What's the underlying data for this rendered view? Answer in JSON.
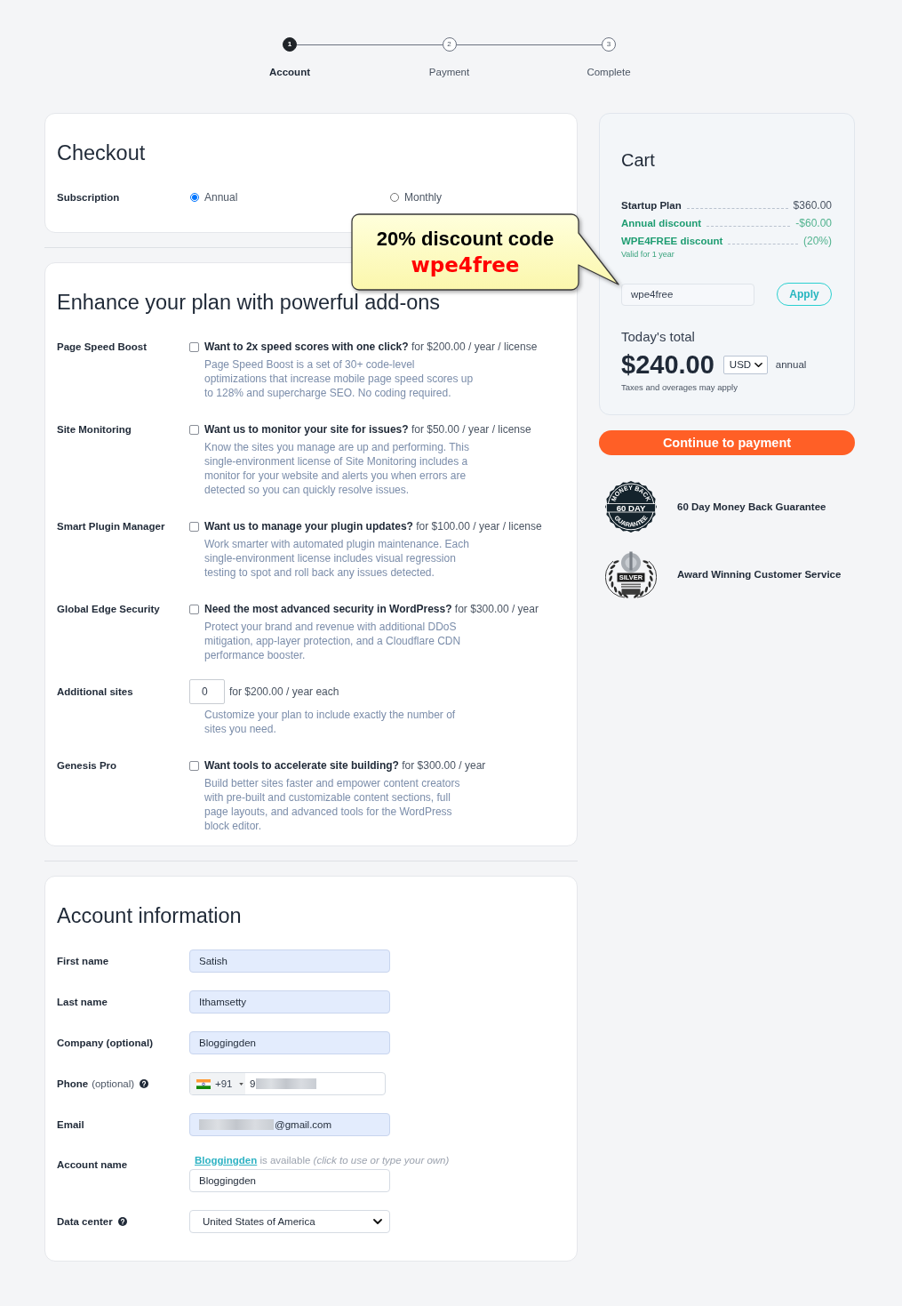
{
  "stepper": {
    "steps": [
      {
        "number": "1",
        "label": "Account",
        "selected": true
      },
      {
        "number": "2",
        "label": "Payment",
        "selected": false
      },
      {
        "number": "3",
        "label": "Complete",
        "selected": false
      }
    ]
  },
  "checkout": {
    "title": "Checkout",
    "subscription": {
      "label": "Subscription",
      "options": [
        {
          "label": "Annual",
          "selected": true
        },
        {
          "label": "Monthly",
          "selected": false
        }
      ]
    }
  },
  "callout": {
    "title": "20% discount code",
    "code": "wpe4free"
  },
  "addons": {
    "title": "Enhance your plan with powerful add-ons",
    "items": [
      {
        "kind": "checkbox",
        "name": "Page Speed Boost",
        "checked": false,
        "offer": "**Want to 2x speed scores with one click?** for $200.00 / year / license",
        "description": "Page Speed Boost is a set of 30+ code-level optimizations that increase mobile page speed scores up to 128% and supercharge SEO. No coding required."
      },
      {
        "kind": "checkbox",
        "name": "Site Monitoring",
        "checked": false,
        "offer": "**Want us to monitor your site for issues?** for $50.00 / year / license",
        "description": "Know the sites you manage are up and performing. This single-environment license of Site Monitoring includes a monitor for your website and alerts you when errors are detected so you can quickly resolve issues."
      },
      {
        "kind": "checkbox",
        "name": "Smart Plugin Manager",
        "checked": false,
        "offer": "**Want us to manage your plugin updates?** for $100.00 / year / license",
        "description": "Work smarter with automated plugin maintenance. Each single-environment license includes visual regression testing to spot and roll back any issues detected."
      },
      {
        "kind": "checkbox",
        "name": "Global Edge Security",
        "checked": false,
        "offer": "**Need the most advanced security in WordPress?** for $300.00 / year",
        "description": "Protect your brand and revenue with additional DDoS mitigation, app-layer protection, and a Cloudflare CDN performance booster."
      },
      {
        "kind": "number",
        "name": "Additional sites",
        "value": "0",
        "offer": "for $200.00 / year each",
        "description": "Customize your plan to include exactly the number of sites you need."
      },
      {
        "kind": "checkbox",
        "name": "Genesis Pro",
        "checked": false,
        "offer": "**Want tools to accelerate site building?** for $300.00 / year",
        "description": "Build better sites faster and empower content creators with pre-built and customizable content sections, full page layouts, and advanced tools for the WordPress block editor."
      }
    ]
  },
  "account": {
    "title": "Account information",
    "fields": [
      {
        "kind": "text",
        "label": "First name",
        "value": "Satish",
        "autofilled": true,
        "help": false,
        "redacted": false
      },
      {
        "kind": "text",
        "label": "Last name",
        "value": "Ithamsetty",
        "autofilled": true,
        "help": false,
        "redacted": false
      },
      {
        "kind": "text",
        "label": "Company (optional)",
        "value": "Bloggingden",
        "autofilled": true,
        "help": false,
        "redacted": false
      },
      {
        "kind": "phone",
        "label": "Phone",
        "note": "(optional)",
        "code": "+91",
        "value": "9",
        "autofilled": false,
        "help": true,
        "redacted": true
      },
      {
        "kind": "text",
        "label": "Email",
        "value": "@gmail.com",
        "autofilled": true,
        "help": false,
        "redacted": true
      },
      {
        "kind": "account",
        "label": "Account name",
        "suggestion": "Bloggingden",
        "availability": "is available",
        "hint": "(click to use or type your own)",
        "value": "Bloggingden",
        "autofilled": false,
        "help": false,
        "redacted": false
      },
      {
        "kind": "select",
        "label": "Data center",
        "value": "United States of America",
        "autofilled": false,
        "help": true,
        "redacted": false
      }
    ]
  },
  "cart": {
    "title": "Cart",
    "lines": [
      {
        "kind": "plan",
        "label": "Startup Plan",
        "amount": "$360.00"
      },
      {
        "kind": "discount",
        "label": "Annual discount",
        "amount": "-$60.00"
      },
      {
        "kind": "discount",
        "label": "WPE4FREE discount",
        "amount": "(20%)",
        "note": "Valid for 1 year"
      }
    ],
    "coupon": {
      "value": "wpe4free",
      "button": "Apply"
    },
    "total": {
      "label": "Today's total",
      "amount": "$240.00",
      "currency": "USD",
      "period": "annual",
      "note": "Taxes and overages may apply"
    }
  },
  "continue_button": "Continue to payment",
  "guarantees": [
    {
      "kind": "money_back",
      "badge_text": [
        "MONEY BACK",
        "60 DAY",
        "GUARANTEE"
      ],
      "text": "60 Day Money Back Guarantee"
    },
    {
      "kind": "award",
      "badge_text": [
        "SILVER"
      ],
      "text": "Award Winning Customer Service"
    }
  ]
}
